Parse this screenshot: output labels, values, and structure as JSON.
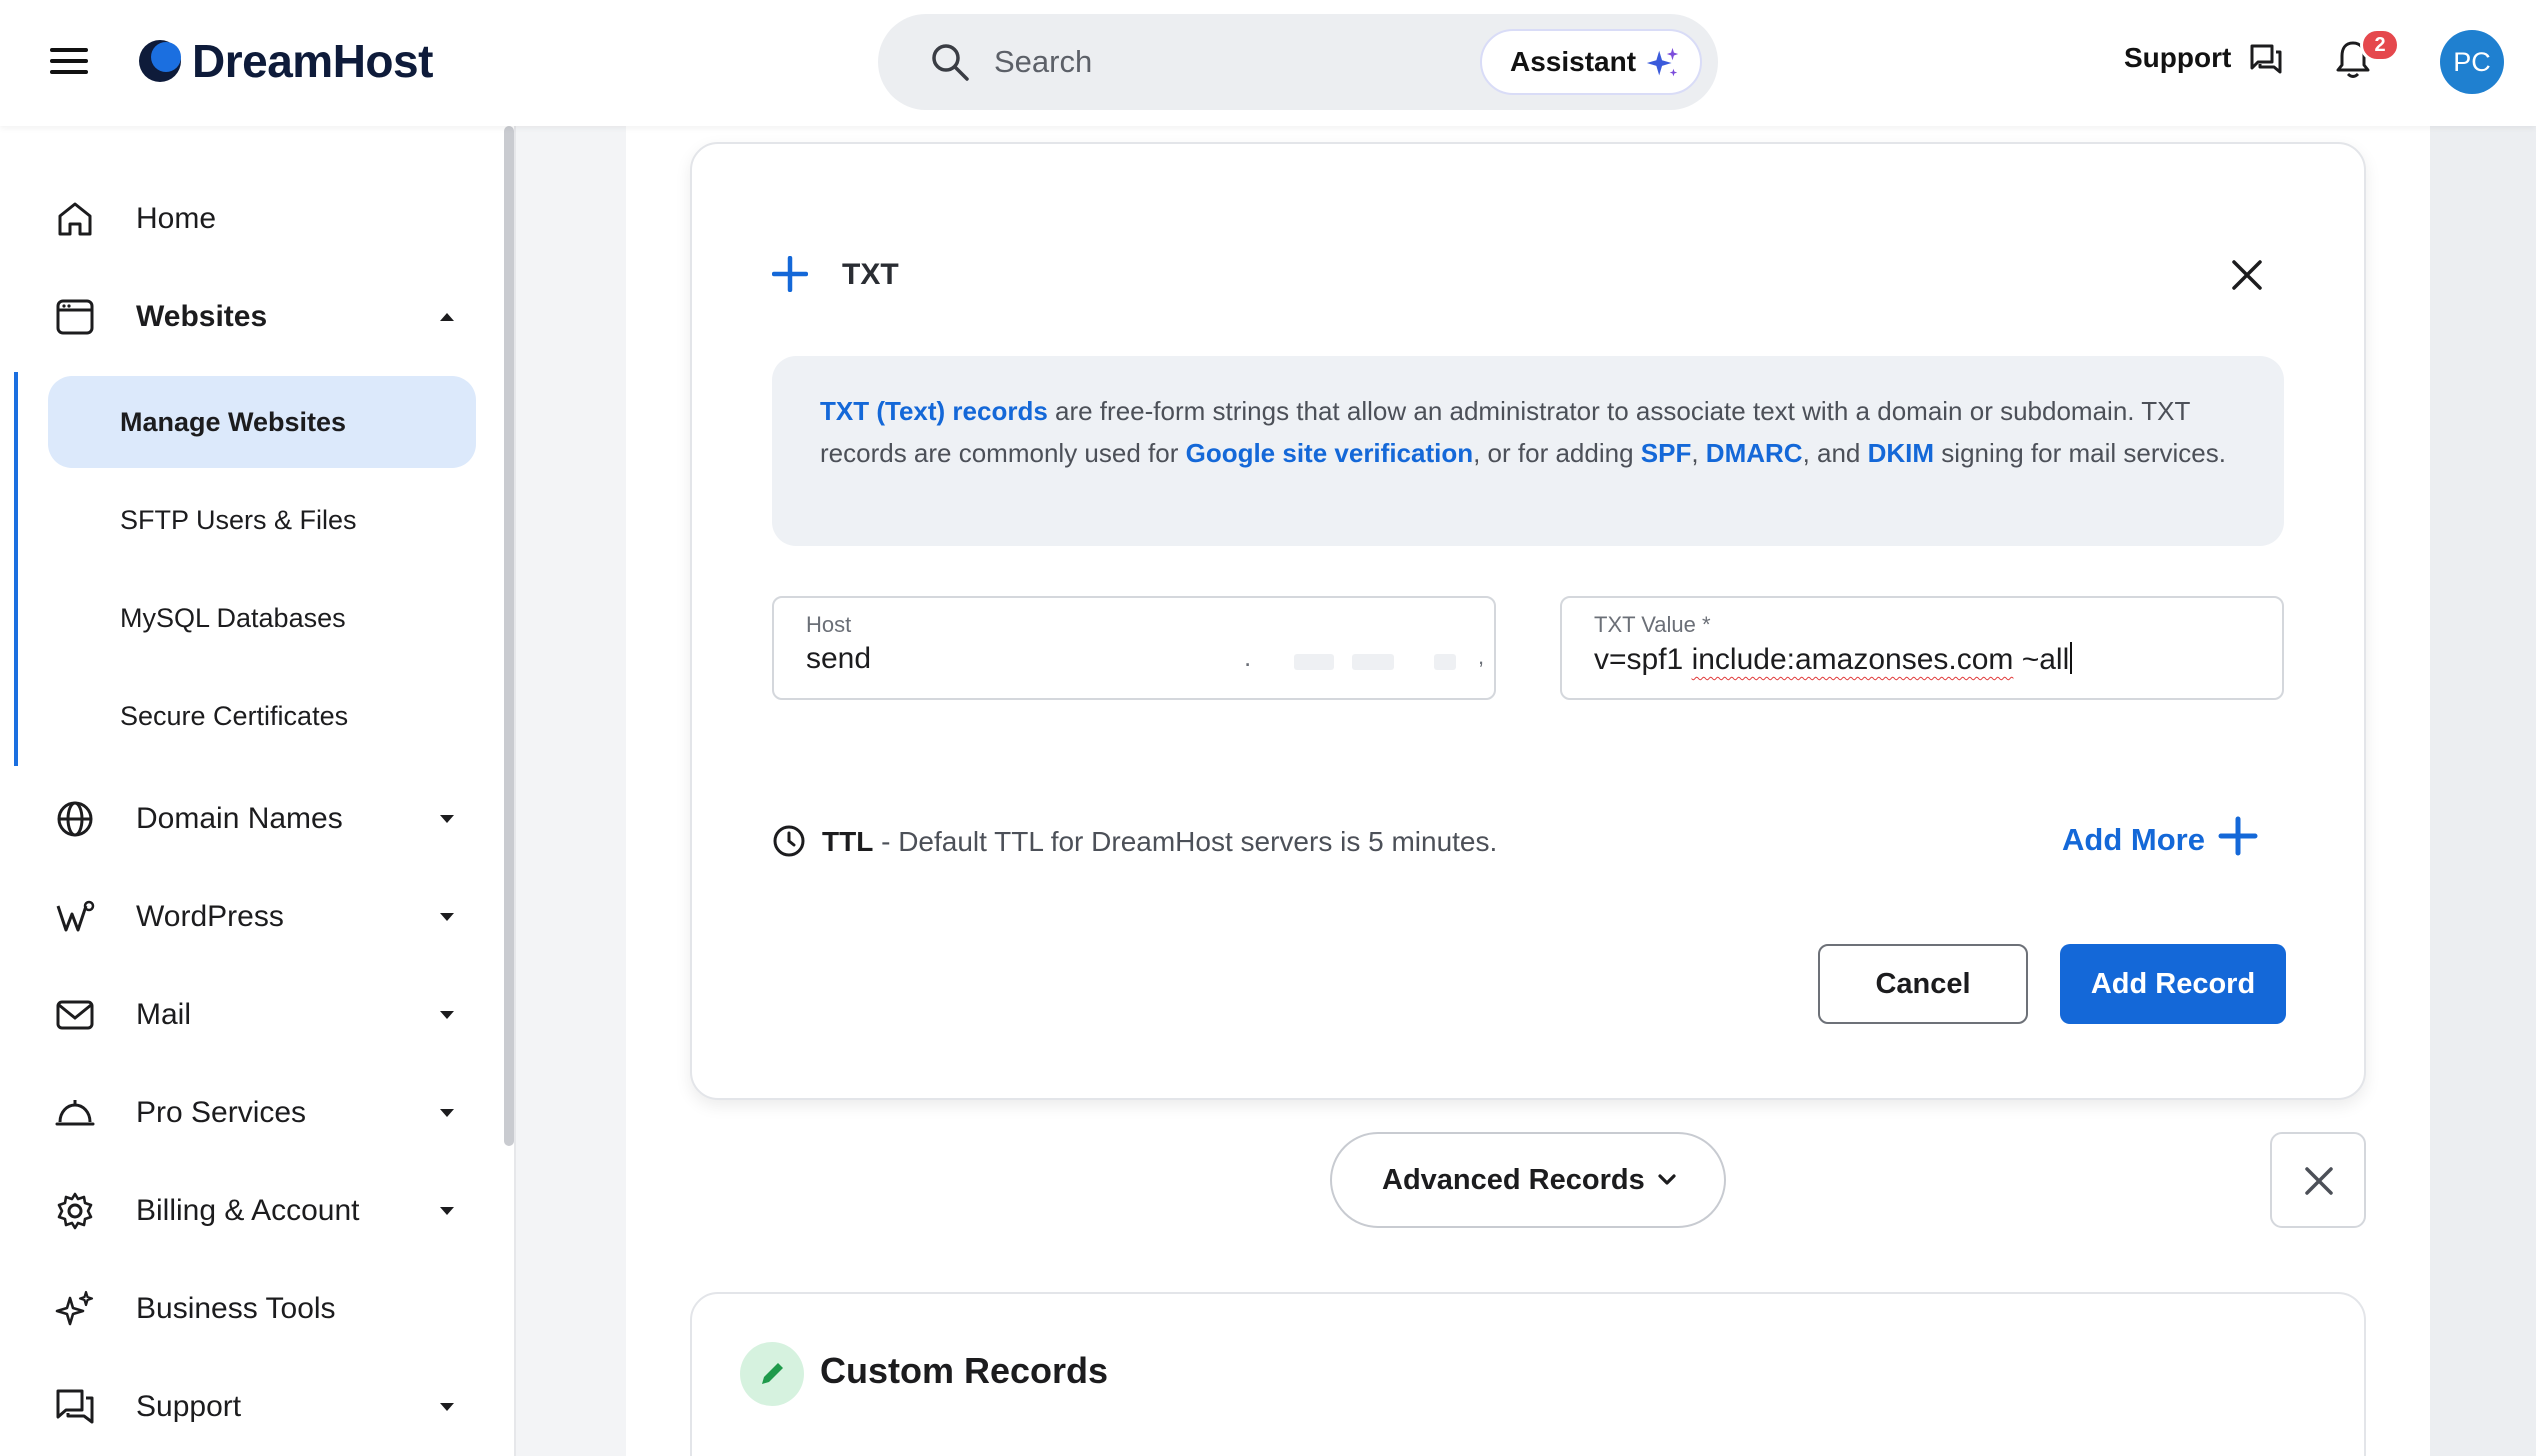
{
  "header": {
    "brand": "DreamHost",
    "search_placeholder": "Search",
    "assistant_label": "Assistant",
    "support_label": "Support",
    "notifications_count": "2",
    "avatar_initials": "PC"
  },
  "sidebar": {
    "items": [
      {
        "label": "Home",
        "icon": "home-icon"
      },
      {
        "label": "Websites",
        "icon": "browser-window-icon",
        "expanded": true
      },
      {
        "label": "Domain Names",
        "icon": "globe-icon"
      },
      {
        "label": "WordPress",
        "icon": "wordpress-icon"
      },
      {
        "label": "Mail",
        "icon": "mail-icon"
      },
      {
        "label": "Pro Services",
        "icon": "service-bell-icon"
      },
      {
        "label": "Billing & Account",
        "icon": "gear-icon"
      },
      {
        "label": "Business Tools",
        "icon": "sparkles-icon"
      },
      {
        "label": "Support",
        "icon": "chat-icon"
      }
    ],
    "websites_sub": [
      {
        "label": "Manage Websites",
        "active": true
      },
      {
        "label": "SFTP Users & Files"
      },
      {
        "label": "MySQL Databases"
      },
      {
        "label": "Secure Certificates"
      }
    ]
  },
  "modal": {
    "record_type": "TXT",
    "info": {
      "link1": "TXT (Text) records",
      "text1": " are free-form strings that allow an administrator to associate text with a domain or subdomain. TXT records are commonly used for ",
      "link2": "Google site verification",
      "text2": ", or for adding ",
      "link3": "SPF",
      "text3": ", ",
      "link4": "DMARC",
      "text4": ", and ",
      "link5": "DKIM",
      "text5": " signing for mail services."
    },
    "host": {
      "label": "Host",
      "value": "send",
      "suffix_dot": ".",
      "suffix_comma": ","
    },
    "txt_value": {
      "label": "TXT Value *",
      "value_part1": "v=spf1 ",
      "value_part2": "include:amazonses.com",
      "value_part3": " ~all"
    },
    "ttl_bold": "TTL",
    "ttl_text": " - Default TTL for DreamHost servers is 5 minutes.",
    "add_more_label": "Add More",
    "cancel_label": "Cancel",
    "add_record_label": "Add Record"
  },
  "advanced_records_label": "Advanced Records",
  "custom_records_title": "Custom Records",
  "colors": {
    "accent": "#1468d8",
    "active_nav_bg": "#dce9fb",
    "badge": "#e5484d",
    "avatar": "#1f80d0"
  }
}
